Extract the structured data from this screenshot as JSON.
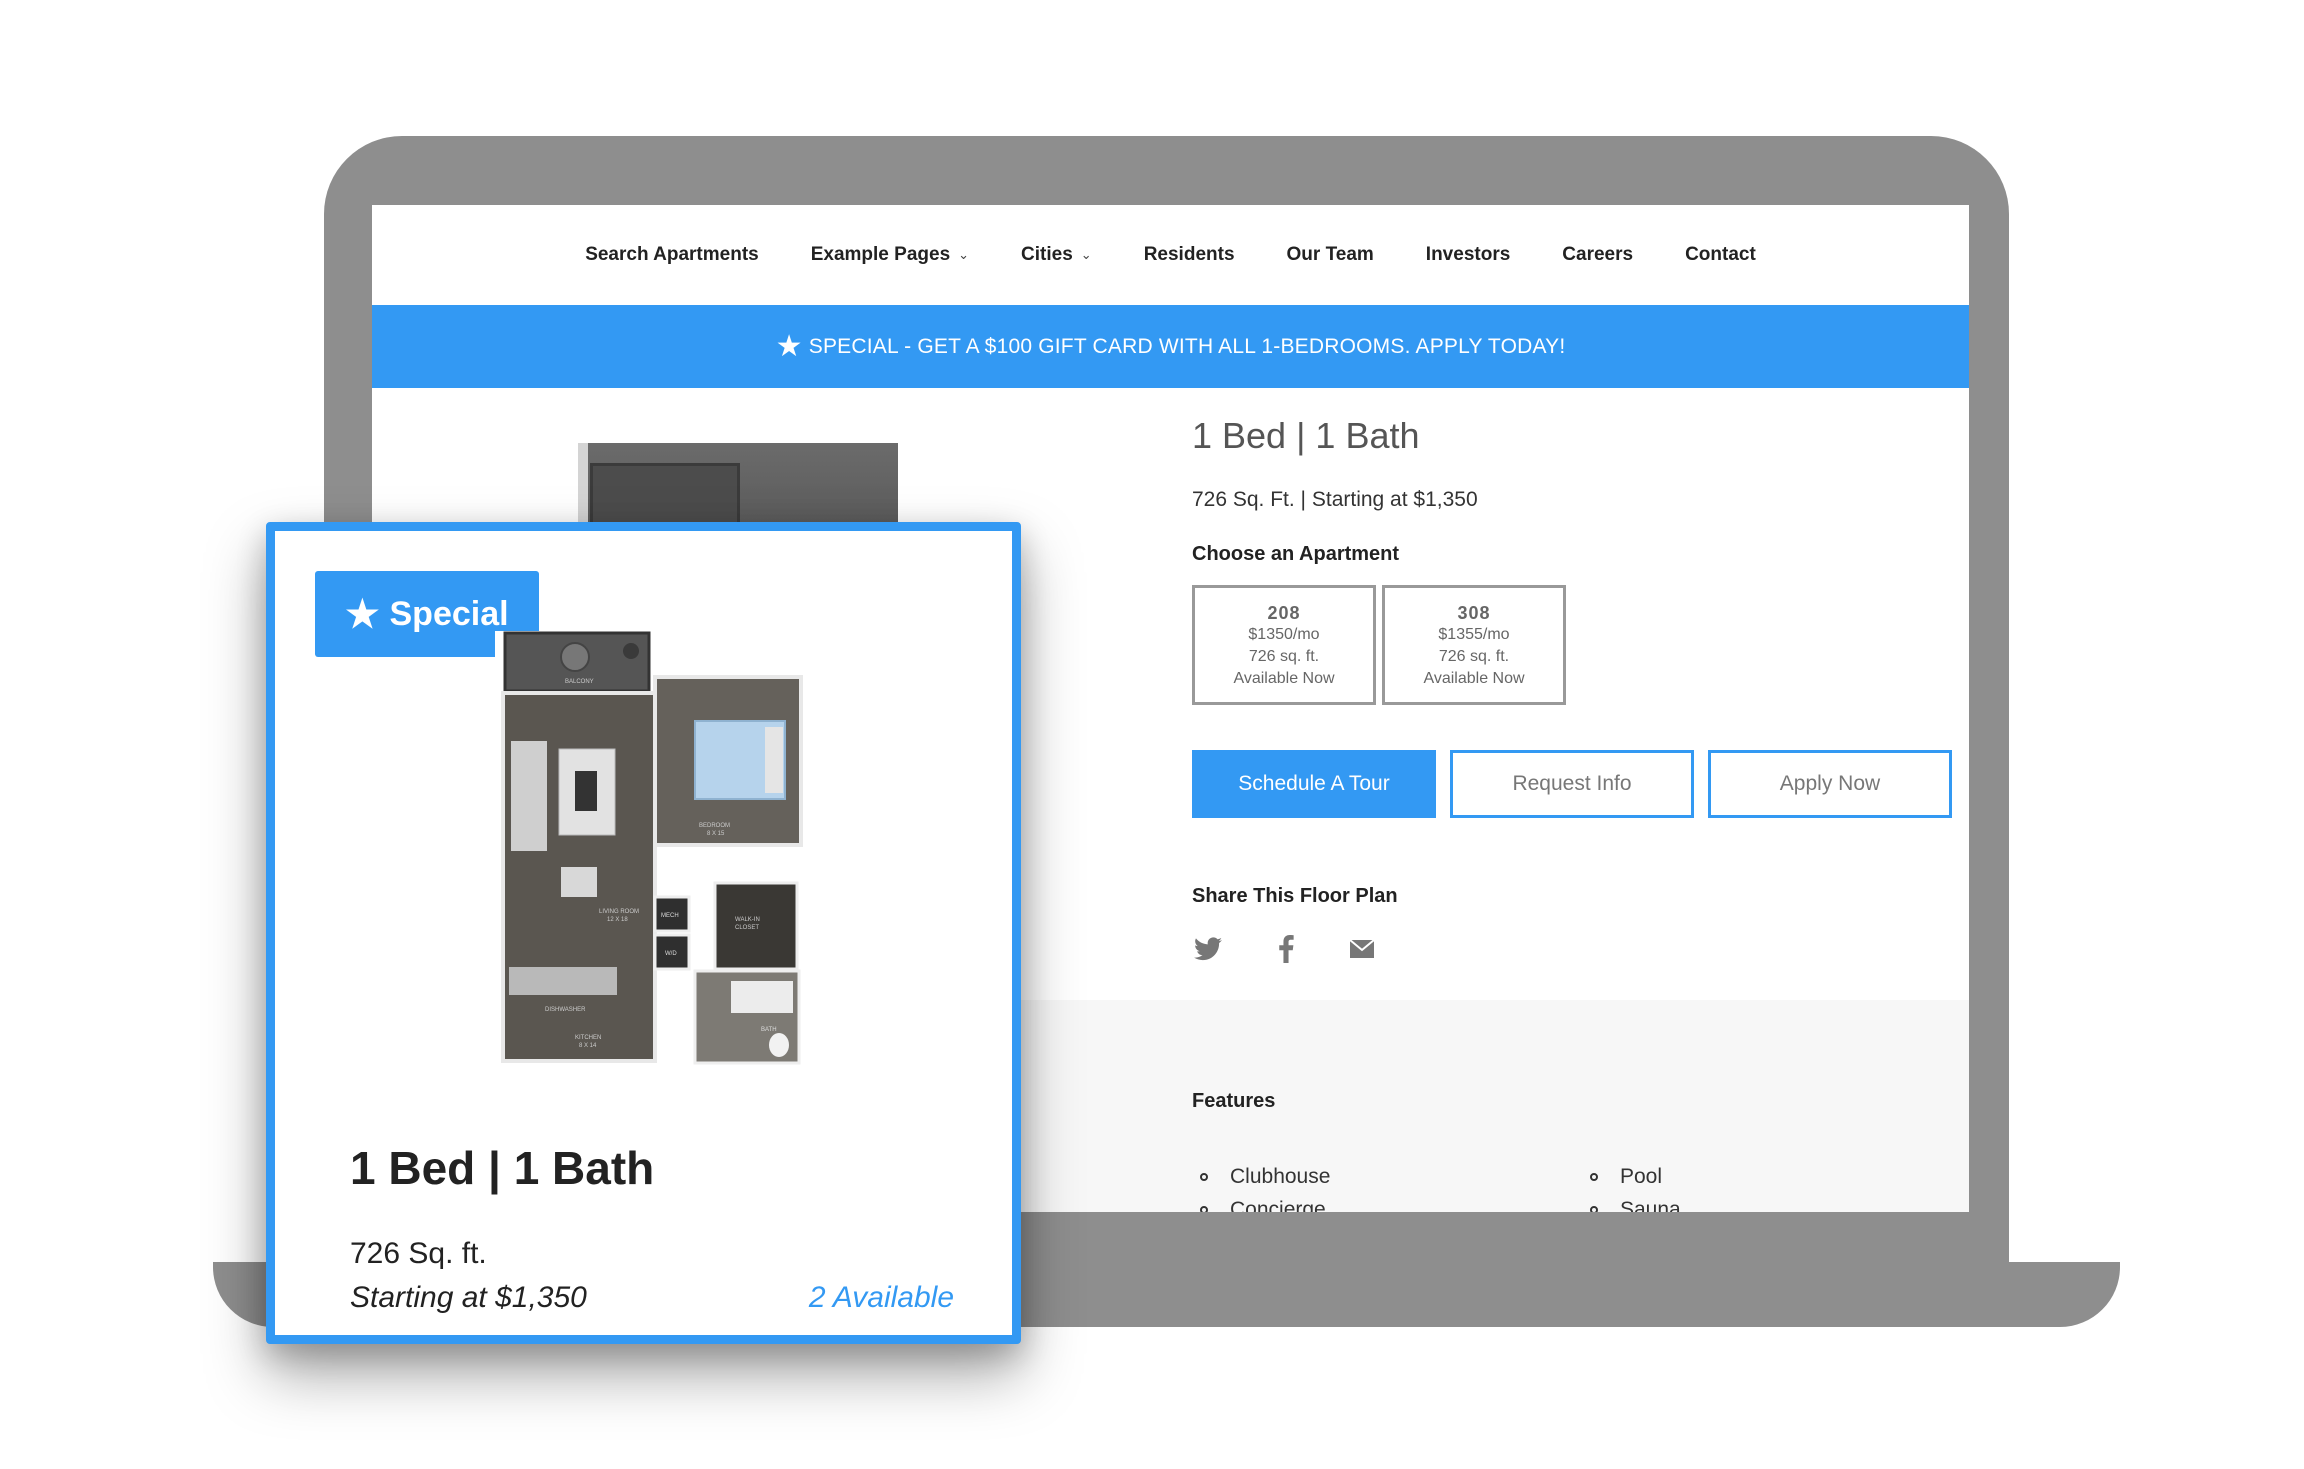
{
  "nav": {
    "items": [
      {
        "label": "Search Apartments",
        "dropdown": false
      },
      {
        "label": "Example Pages",
        "dropdown": true
      },
      {
        "label": "Cities",
        "dropdown": true
      },
      {
        "label": "Residents",
        "dropdown": false
      },
      {
        "label": "Our Team",
        "dropdown": false
      },
      {
        "label": "Investors",
        "dropdown": false
      },
      {
        "label": "Careers",
        "dropdown": false
      },
      {
        "label": "Contact",
        "dropdown": false
      }
    ]
  },
  "banner": {
    "text": "SPECIAL - GET A $100 GIFT CARD WITH ALL 1-BEDROOMS. APPLY TODAY!"
  },
  "details": {
    "title": "1 Bed | 1 Bath",
    "subtitle": "726 Sq. Ft. | Starting at $1,350",
    "choose_label": "Choose an Apartment",
    "apartments": [
      {
        "number": "208",
        "price": "$1350/mo",
        "size": "726 sq. ft.",
        "availability": "Available Now"
      },
      {
        "number": "308",
        "price": "$1355/mo",
        "size": "726 sq. ft.",
        "availability": "Available Now"
      }
    ],
    "buttons": {
      "schedule": "Schedule A Tour",
      "request": "Request Info",
      "apply": "Apply Now"
    },
    "share_label": "Share This Floor Plan"
  },
  "features": {
    "label": "Features",
    "items": [
      "Clubhouse",
      "Pool",
      "Concierge",
      "Sauna"
    ]
  },
  "card": {
    "badge": "Special",
    "title": "1 Bed | 1 Bath",
    "sqft": "726 Sq. ft.",
    "price": "Starting at $1,350",
    "available": "2 Available"
  },
  "floorplan_labels": {
    "balcony": "BALCONY",
    "living": "LIVING ROOM",
    "living_dims": "12 X 18",
    "bedroom": "BEDROOM",
    "bedroom_dims": "8 X 15",
    "walkin": "WALK-IN",
    "closet": "CLOSET",
    "kitchen": "KITCHEN",
    "kitchen_dims": "8 X 14",
    "dishwasher": "DISHWASHER",
    "bath": "BATH",
    "mech": "MECH",
    "wd": "W/D"
  },
  "colors": {
    "accent": "#3399f3",
    "laptop": "#8e8e8e"
  }
}
